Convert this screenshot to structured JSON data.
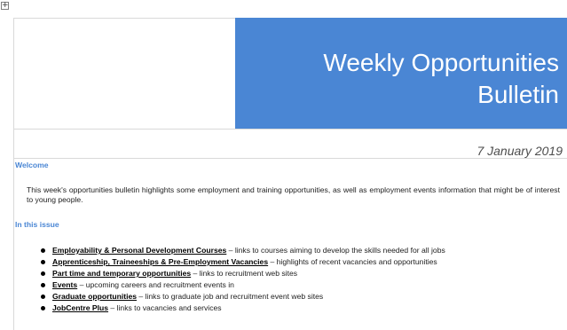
{
  "header": {
    "title_line1": "Weekly Opportunities",
    "title_line2": "Bulletin",
    "date": "7 January 2019"
  },
  "welcome": {
    "heading": "Welcome",
    "text": "This week's opportunities bulletin highlights some employment and training opportunities, as well as employment events information that might be of interest to young people."
  },
  "in_this_issue": {
    "heading": "In this issue",
    "items": [
      {
        "title": "Employability & Personal Development Courses",
        "desc": " – links to courses aiming to develop the skills needed for all jobs"
      },
      {
        "title": "Apprenticeship, Traineeships & Pre-Employment Vacancies",
        "desc": " – highlights of recent vacancies and opportunities"
      },
      {
        "title": "Part time and temporary opportunities",
        "desc": " – links to recruitment web sites"
      },
      {
        "title": "Events",
        "desc": " – upcoming careers and recruitment events in"
      },
      {
        "title": "Graduate opportunities",
        "desc": " – links to graduate job and recruitment event web sites"
      },
      {
        "title": "JobCentre Plus",
        "desc": " – links to vacancies and services"
      }
    ]
  },
  "colors": {
    "accent": "#4a86d4"
  }
}
